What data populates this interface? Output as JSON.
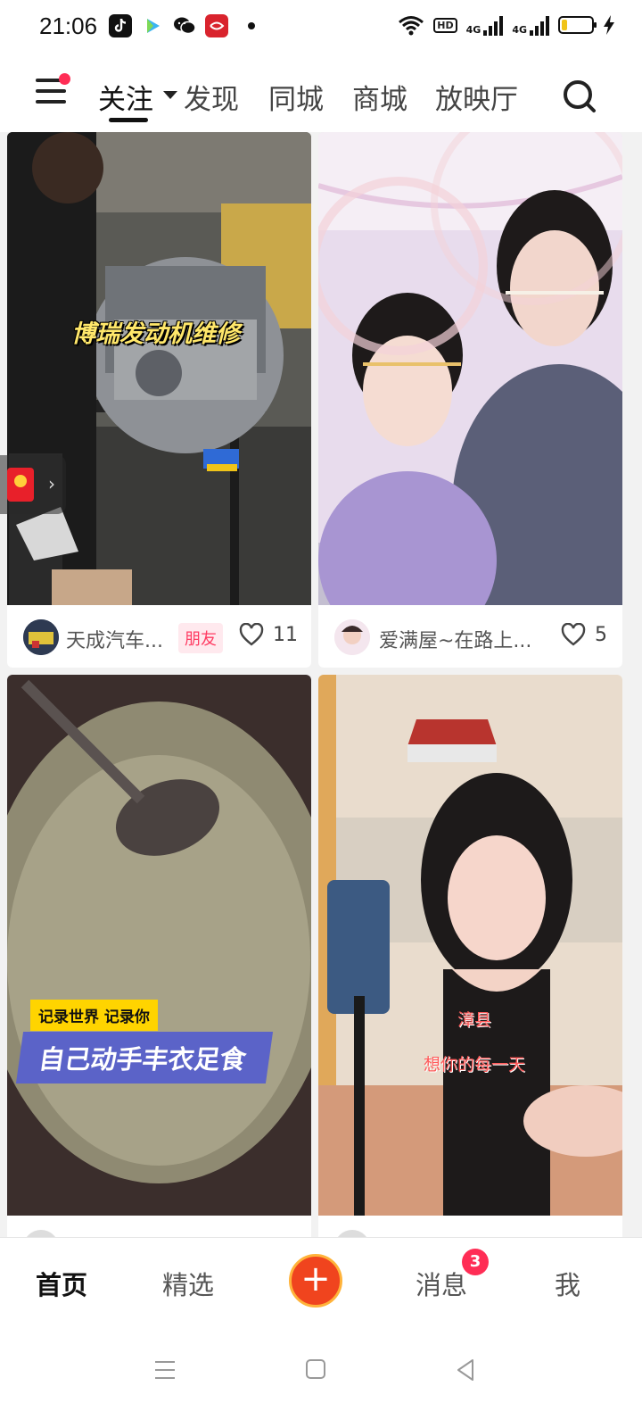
{
  "status_bar": {
    "time": "21:06",
    "app_icons": [
      "tiktok-icon",
      "video-play-icon",
      "wechat-icon",
      "red-app-icon"
    ],
    "network_labels": [
      "HD",
      "4G",
      "4G"
    ],
    "battery_level": 0.2,
    "icons": [
      "wifi-icon",
      "signal-icon",
      "battery-icon",
      "charging-icon"
    ]
  },
  "top_nav": {
    "tabs": [
      {
        "label": "关注"
      },
      {
        "label": "发现"
      },
      {
        "label": "同城"
      },
      {
        "label": "商城"
      },
      {
        "label": "放映厅"
      }
    ],
    "active_tab": "关注",
    "has_notification_dot": true
  },
  "feed": {
    "cards": [
      {
        "caption": "博瑞发动机维修",
        "author": "天成汽车...",
        "badge": "朋友",
        "likes": "11"
      },
      {
        "caption": "",
        "author": "爱满屋~在路上...",
        "badge": "",
        "likes": "5"
      },
      {
        "caption_tag": "记录世界 记录你",
        "caption": "自己动手丰衣足食",
        "author": "",
        "likes": ""
      },
      {
        "caption_line1": "漳县",
        "caption_line2": "想你的每一天",
        "author": "",
        "likes": ""
      }
    ]
  },
  "bottom_nav": {
    "tabs": [
      {
        "label": "首页"
      },
      {
        "label": "精选"
      },
      {
        "label": "消息",
        "badge": "3"
      },
      {
        "label": "我"
      }
    ],
    "active_tab": "首页",
    "plus_label": "+"
  },
  "colors": {
    "accent": "#ff2d55",
    "plus": "#f0441e",
    "tag_yellow": "#ffd400",
    "caption_blue": "#5b63c8"
  }
}
